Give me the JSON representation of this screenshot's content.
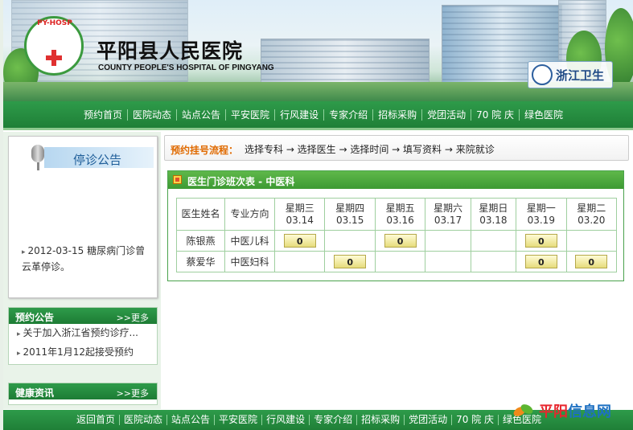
{
  "header": {
    "logo_text": "PY-HOSP",
    "title": "平阳县人民医院",
    "subtitle": "COUNTY PEOPLE'S HOSPITAL OF PINGYANG",
    "badge": "浙江卫生"
  },
  "topnav": [
    "预约首页",
    "医院动态",
    "站点公告",
    "平安医院",
    "行风建设",
    "专家介绍",
    "招标采购",
    "党团活动",
    "70 院 庆",
    "绿色医院"
  ],
  "notice": {
    "title": "停诊公告",
    "item": "2012-03-15 糖尿病门诊曾云革停诊。"
  },
  "booking_panel": {
    "title": "预约公告",
    "more": ">>更多",
    "items": [
      "关于加入浙江省预约诊疗...",
      "2011年1月12起接受预约"
    ]
  },
  "health_panel": {
    "title": "健康资讯",
    "more": ">>更多"
  },
  "flow": {
    "label": "预约挂号流程：",
    "steps": "选择专科 → 选择医生 → 选择时间 → 填写资料 → 来院就诊"
  },
  "schedule": {
    "title": "医生门诊班次表 - 中医科",
    "col_doctor": "医生姓名",
    "col_specialty": "专业方向",
    "days": [
      {
        "week": "星期三",
        "date": "03.14"
      },
      {
        "week": "星期四",
        "date": "03.15"
      },
      {
        "week": "星期五",
        "date": "03.16"
      },
      {
        "week": "星期六",
        "date": "03.17"
      },
      {
        "week": "星期日",
        "date": "03.18"
      },
      {
        "week": "星期一",
        "date": "03.19"
      },
      {
        "week": "星期二",
        "date": "03.20"
      }
    ],
    "rows": [
      {
        "doctor": "陈银燕",
        "specialty": "中医儿科",
        "slots": [
          "0",
          "",
          "0",
          "",
          "",
          "0",
          ""
        ]
      },
      {
        "doctor": "蔡爱华",
        "specialty": "中医妇科",
        "slots": [
          "",
          "0",
          "",
          "",
          "",
          "0",
          "0"
        ]
      }
    ]
  },
  "footnav": [
    "返回首页",
    "医院动态",
    "站点公告",
    "平安医院",
    "行风建设",
    "专家介绍",
    "招标采购",
    "党团活动",
    "70 院 庆",
    "绿色医院"
  ],
  "watermark": {
    "red": "平阳",
    "blue": "信息网"
  }
}
